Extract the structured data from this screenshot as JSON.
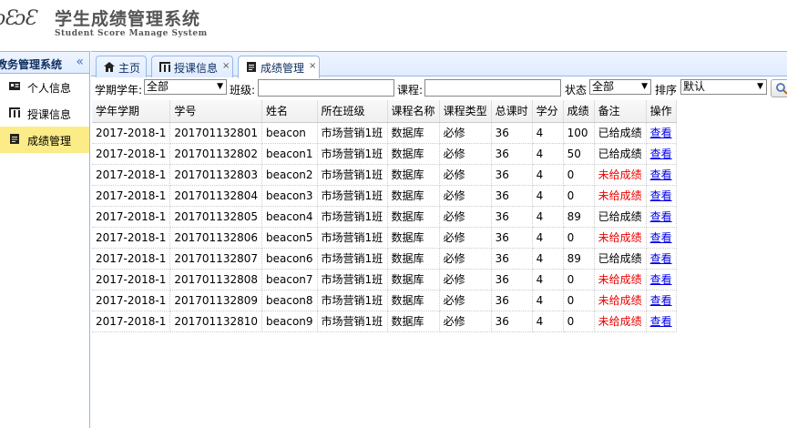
{
  "header": {
    "logo_text": "ᴐƐᴐƐ",
    "title": "学生成绩管理系统",
    "subtitle": "Student Score Manage System"
  },
  "sidebar": {
    "title": "教务管理系统",
    "collapse_icon": "double-chevron-left-icon",
    "items": [
      {
        "label": "个人信息",
        "icon": "id-card-icon",
        "active": false
      },
      {
        "label": "授课信息",
        "icon": "sitemap-icon",
        "active": false
      },
      {
        "label": "成绩管理",
        "icon": "document-icon",
        "active": true
      }
    ]
  },
  "tabs": [
    {
      "label": "主页",
      "icon": "home-icon",
      "closable": false
    },
    {
      "label": "授课信息",
      "icon": "sitemap-icon",
      "closable": true
    },
    {
      "label": "成绩管理",
      "icon": "document-icon",
      "closable": true,
      "selected": true
    }
  ],
  "toolbar": {
    "term_label": "学期学年:",
    "term_value": "全部",
    "class_label": "班级:",
    "class_value": "",
    "course_label": "课程:",
    "course_value": "",
    "status_label": "状态",
    "status_value": "全部",
    "sort_label": "排序",
    "sort_value": "默认",
    "close_glyph": "×"
  },
  "table": {
    "columns": [
      "学年学期",
      "学号",
      "姓名",
      "所在班级",
      "课程名称",
      "课程类型",
      "总课时",
      "学分",
      "成绩",
      "备注",
      "操作"
    ],
    "rows": [
      [
        "2017-2018-1",
        "201701132801",
        "beacon",
        "市场营销1班",
        "数据库",
        "必修",
        "36",
        "4",
        "100",
        "已给成绩",
        "查看"
      ],
      [
        "2017-2018-1",
        "201701132802",
        "beacon1",
        "市场营销1班",
        "数据库",
        "必修",
        "36",
        "4",
        "50",
        "已给成绩",
        "查看"
      ],
      [
        "2017-2018-1",
        "201701132803",
        "beacon2",
        "市场营销1班",
        "数据库",
        "必修",
        "36",
        "4",
        "0",
        "未给成绩",
        "查看"
      ],
      [
        "2017-2018-1",
        "201701132804",
        "beacon3",
        "市场营销1班",
        "数据库",
        "必修",
        "36",
        "4",
        "0",
        "未给成绩",
        "查看"
      ],
      [
        "2017-2018-1",
        "201701132805",
        "beacon4",
        "市场营销1班",
        "数据库",
        "必修",
        "36",
        "4",
        "89",
        "已给成绩",
        "查看"
      ],
      [
        "2017-2018-1",
        "201701132806",
        "beacon5",
        "市场营销1班",
        "数据库",
        "必修",
        "36",
        "4",
        "0",
        "未给成绩",
        "查看"
      ],
      [
        "2017-2018-1",
        "201701132807",
        "beacon6",
        "市场营销1班",
        "数据库",
        "必修",
        "36",
        "4",
        "89",
        "已给成绩",
        "查看"
      ],
      [
        "2017-2018-1",
        "201701132808",
        "beacon7",
        "市场营销1班",
        "数据库",
        "必修",
        "36",
        "4",
        "0",
        "未给成绩",
        "查看"
      ],
      [
        "2017-2018-1",
        "201701132809",
        "beacon8",
        "市场营销1班",
        "数据库",
        "必修",
        "36",
        "4",
        "0",
        "未给成绩",
        "查看"
      ],
      [
        "2017-2018-1",
        "201701132810",
        "beacon9",
        "市场营销1班",
        "数据库",
        "必修",
        "36",
        "4",
        "0",
        "未给成绩",
        "查看"
      ]
    ]
  },
  "colors": {
    "border": "#95b8e7",
    "active_menu": "#fbec88",
    "not_graded": "#ee0000",
    "link": "#0000ee"
  }
}
